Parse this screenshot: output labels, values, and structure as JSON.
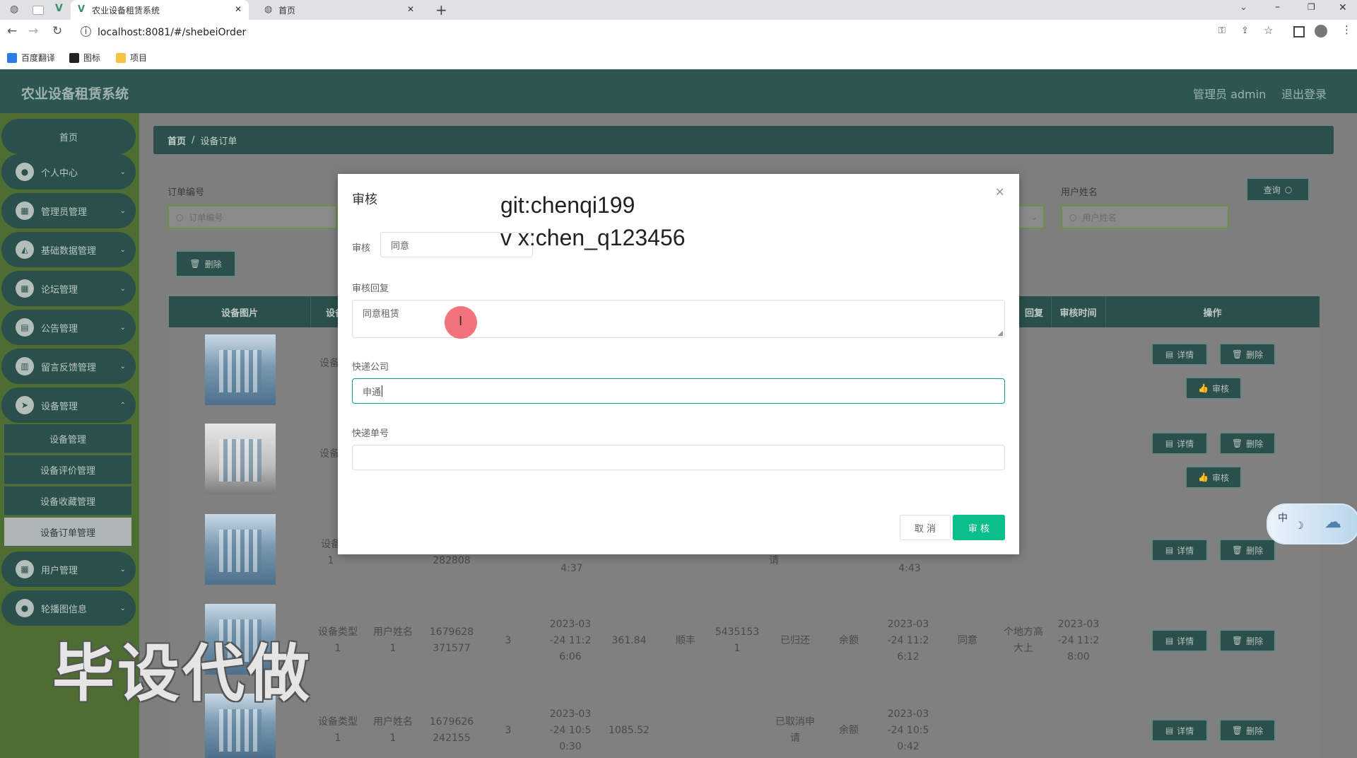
{
  "browser": {
    "tabs": [
      {
        "title": "农业设备租赁系统",
        "active": true
      },
      {
        "title": "首页",
        "active": false
      }
    ],
    "url": "localhost:8081/#/shebeiOrder",
    "bookmarks": [
      "百度翻译",
      "图标",
      "项目"
    ]
  },
  "app": {
    "title": "农业设备租赁系统",
    "user_label": "管理员 admin",
    "logout_label": "退出登录"
  },
  "sidebar": {
    "home": "首页",
    "items": [
      "个人中心",
      "管理员管理",
      "基础数据管理",
      "论坛管理",
      "公告管理",
      "留言反馈管理",
      "设备管理"
    ],
    "subitems": [
      "设备管理",
      "设备评价管理",
      "设备收藏管理",
      "设备订单管理"
    ],
    "items_after": [
      "用户管理",
      "轮播图信息"
    ]
  },
  "breadcrumb": {
    "home": "首页",
    "sep": "/",
    "current": "设备订单"
  },
  "filters": {
    "order_no_label": "订单编号",
    "order_no_placeholder": "订单编号",
    "username_label": "用户姓名",
    "username_placeholder": "用户姓名",
    "query_button": "查询",
    "delete_button": "删除"
  },
  "table": {
    "headers": {
      "image": "设备图片",
      "type": "设备",
      "reply": "回复",
      "audit_time": "审核时间",
      "ops": "操作"
    },
    "rows": [
      {
        "type": "设备",
        "actions": [
          "详情",
          "删除",
          "审核"
        ]
      },
      {
        "type": "设备",
        "actions": [
          "详情",
          "删除",
          "审核"
        ]
      },
      {
        "type": "设备",
        "type2": "1",
        "order": "282808",
        "time": "4:37",
        "status": "请",
        "paytime": "4:43",
        "actions": [
          "详情",
          "删除"
        ]
      },
      {
        "type": "设备类型",
        "type2": "1",
        "user": "用户姓名",
        "user2": "1",
        "order": "1679628",
        "order2": "371577",
        "qty": "3",
        "time": "2023-03",
        "time2": "-24 11:2",
        "time3": "6:06",
        "price": "361.84",
        "express": "顺丰",
        "expno": "5435153",
        "expno2": "1",
        "status": "已归还",
        "pay": "余额",
        "paytime": "2023-03",
        "paytime2": "-24 11:2",
        "paytime3": "6:12",
        "audit": "同意",
        "reply": "个地方高",
        "reply2": "大上",
        "atime": "2023-03",
        "atime2": "-24 11:2",
        "atime3": "8:00",
        "actions": [
          "详情",
          "删除"
        ]
      },
      {
        "type": "设备类型",
        "type2": "1",
        "user": "用户姓名",
        "user2": "1",
        "order": "1679626",
        "order2": "242155",
        "qty": "3",
        "time": "2023-03",
        "time2": "-24 10:5",
        "time3": "0:30",
        "price": "1085.52",
        "status": "已取消申",
        "status2": "请",
        "pay": "余额",
        "paytime": "2023-03",
        "paytime2": "-24 10:5",
        "paytime3": "0:42",
        "actions": [
          "详情",
          "删除"
        ]
      }
    ]
  },
  "dialog": {
    "title": "审核",
    "audit_label": "审核",
    "audit_value": "同意",
    "reply_label": "审核回复",
    "reply_value": "同意租赁",
    "express_label": "快递公司",
    "express_value": "申通",
    "expno_label": "快递单号",
    "expno_value": "",
    "cancel": "取 消",
    "submit": "审 核"
  },
  "overlay": {
    "line1": "git:chenqi199",
    "line2": "v x:chen_q123456",
    "stamp": "毕设代做",
    "ime": "中"
  }
}
